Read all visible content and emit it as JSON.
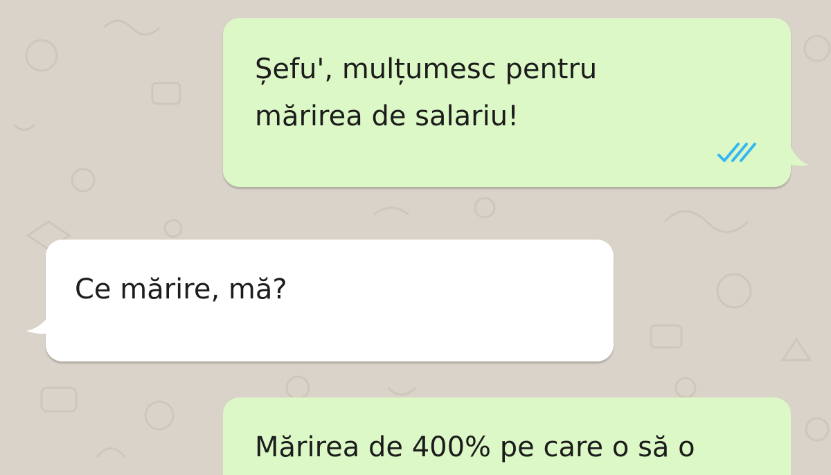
{
  "conversation": {
    "messages": [
      {
        "direction": "outgoing",
        "lines": [
          "Șefu', mulțumesc pentru",
          "mărirea de salariu!"
        ],
        "status_icon": "double-check-read-icon"
      },
      {
        "direction": "incoming",
        "lines": [
          "Ce mărire, mă?"
        ]
      },
      {
        "direction": "outgoing",
        "lines": [
          "Mărirea de 400% pe care o să o"
        ]
      }
    ]
  },
  "colors": {
    "background": "#d9d3c9",
    "outgoing_bubble": "#dcf8c6",
    "incoming_bubble": "#ffffff",
    "read_ticks": "#34b7f1",
    "text": "#1c1c1c"
  }
}
